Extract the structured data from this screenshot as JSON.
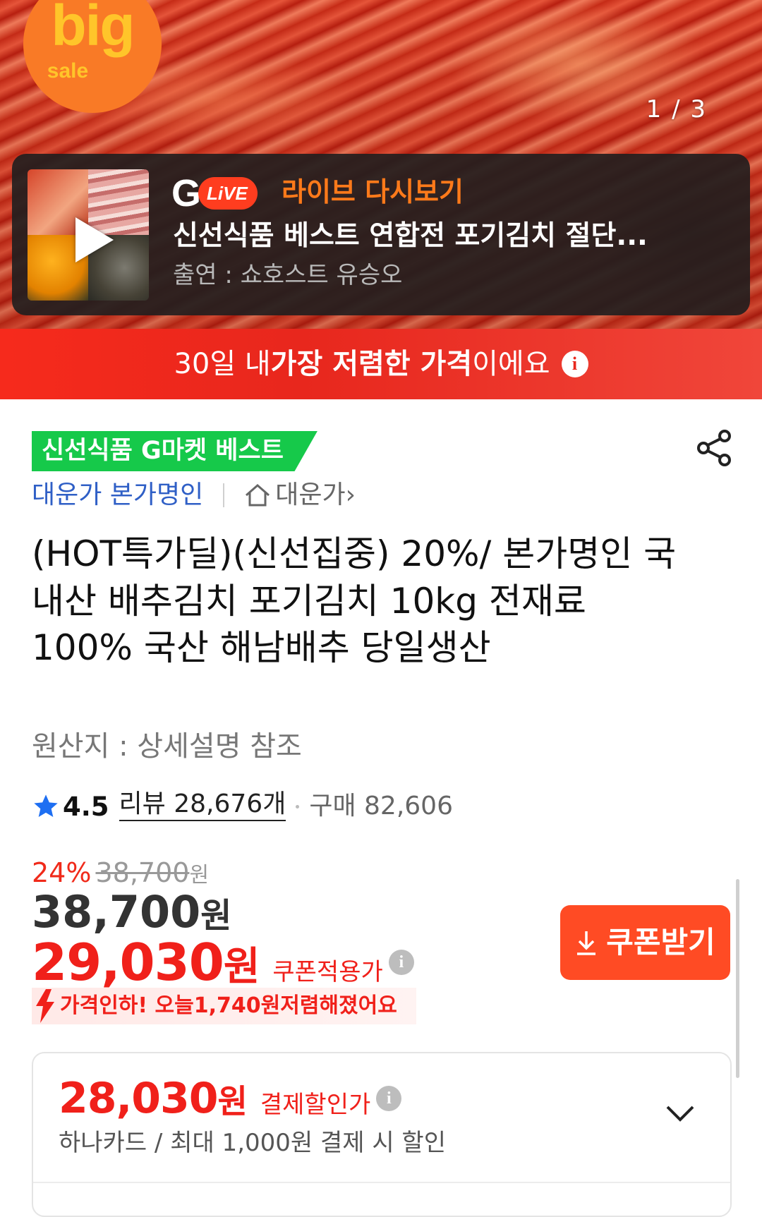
{
  "hero": {
    "badge_big": "big",
    "badge_sale": "sale",
    "counter": "1 / 3"
  },
  "live": {
    "g_logo": "G",
    "live_pill": "LiVE",
    "title": "라이브 다시보기",
    "subtitle": "신선식품 베스트 연합전 포기김치 절단...",
    "host": "출연 : 쇼호스트 유승오"
  },
  "banner": {
    "pre": "30일 내 ",
    "bold": "가장 저렴한 가격",
    "post": "이에요"
  },
  "product": {
    "best_tag": "신선식품 G마켓 베스트",
    "seller": "대운가 본가명인",
    "store": "대운가",
    "store_chevron": "›",
    "title": "(HOT특가딜)(신선집중) 20%/ 본가명인 국내산 배추김치 포기김치 10kg 전재료 100% 국산 해남배추 당일생산",
    "origin": "원산지 : 상세설명 참조",
    "rating": "4.5",
    "reviews": "리뷰 28,676개",
    "purchases": "구매 82,606"
  },
  "price": {
    "discount": "24%",
    "original": "38,700",
    "original_won": "원",
    "sale": "38,700",
    "sale_won": "원",
    "coupon": "29,030",
    "coupon_won": "원",
    "coupon_label": "쿠폰적용가",
    "drop_pre": "가격인하! 오늘 ",
    "drop_amount": "1,740원",
    "drop_post": " 저렴해졌어요",
    "coupon_button": "쿠폰받기"
  },
  "payment": {
    "price": "28,030",
    "won": "원",
    "label": "결제할인가",
    "note": "하나카드 / 최대 1,000원 결제 시 할인"
  },
  "colors": {
    "accent_red": "#f0201a",
    "best_green": "#16c94a",
    "seller_blue": "#2f5fc6",
    "coupon_orange": "#ff4b24",
    "live_orange": "#ff7a1a"
  }
}
